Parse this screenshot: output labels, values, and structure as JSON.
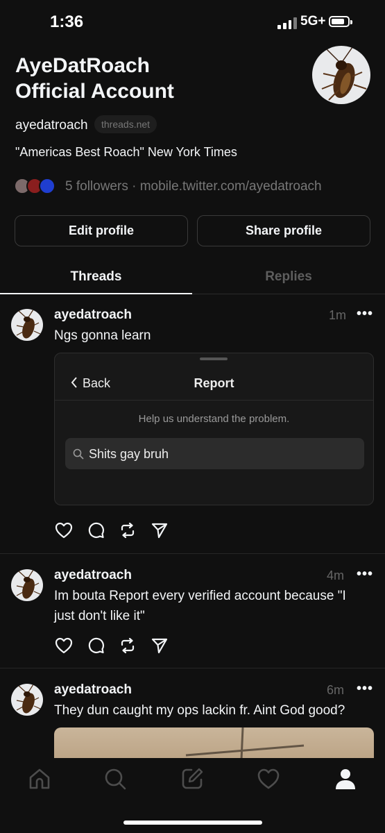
{
  "status_bar": {
    "time": "1:36",
    "network": "5G+"
  },
  "profile": {
    "name": "AyeDatRoach\nOfficial Account",
    "name_line1": "AyeDatRoach",
    "name_line2": "Official Account",
    "handle": "ayedatroach",
    "domain_badge": "threads.net",
    "bio": "\"Americas Best Roach\" New York Times",
    "followers_text": "5 followers",
    "separator": "·",
    "link": "mobile.twitter.com/ayedatroach",
    "avatar_icon": "cockroach-avatar-icon"
  },
  "buttons": {
    "edit": "Edit profile",
    "share": "Share profile"
  },
  "tabs": [
    {
      "label": "Threads",
      "active": true
    },
    {
      "label": "Replies",
      "active": false
    }
  ],
  "posts": [
    {
      "username": "ayedatroach",
      "time": "1m",
      "more": "•••",
      "text": "Ngs gonna learn",
      "embed": {
        "back_label": "Back",
        "title": "Report",
        "help": "Help us understand the problem.",
        "search_value": "Shits gay bruh"
      }
    },
    {
      "username": "ayedatroach",
      "time": "4m",
      "more": "•••",
      "text": "Im bouta Report every verified account because \"I just don't like it\""
    },
    {
      "username": "ayedatroach",
      "time": "6m",
      "more": "•••",
      "text": "They dun caught my ops lackin fr. Aint God good?"
    }
  ],
  "action_icons": [
    "heart-icon",
    "comment-icon",
    "repost-icon",
    "share-icon"
  ],
  "bottom_nav": [
    "home-icon",
    "search-icon",
    "compose-icon",
    "activity-heart-icon",
    "profile-icon"
  ],
  "colors": {
    "background": "#101010",
    "text": "#f3f5f7",
    "muted": "#777777"
  }
}
